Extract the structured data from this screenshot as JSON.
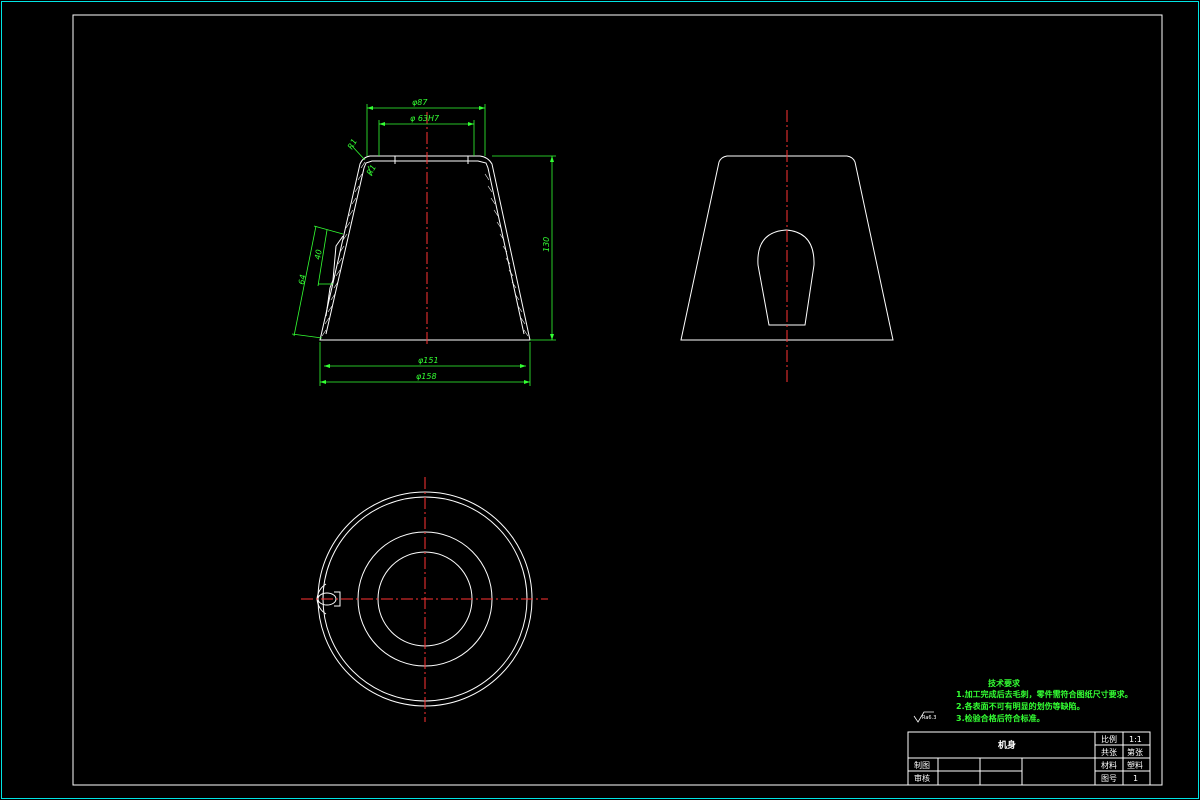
{
  "colors": {
    "background": "#000000",
    "frame": "#00e5e5",
    "geometry": "#ffffff",
    "center_line": "#ff3333",
    "dimension": "#33ff33"
  },
  "dimensions": {
    "top_outer_dia": "φ87",
    "top_inner_dia": "φ 63H7",
    "height": "130",
    "bottom_inner_dia": "φ151",
    "bottom_outer_dia": "φ158",
    "fillet_outer": "R1",
    "fillet_inner": "R1",
    "side_len_a": "64",
    "side_len_b": "40"
  },
  "surface_mark": "Ra6.3",
  "notes": {
    "title": "技术要求",
    "items": [
      "1.加工完成后去毛刺，零件需符合图纸尺寸要求。",
      "2.各表面不可有明显的划伤等缺陷。",
      "3.检验合格后符合标准。"
    ]
  },
  "title_block": {
    "part_name": "机身",
    "scale_label": "比例",
    "scale_value": "1:1",
    "qty_label": "共张",
    "qty_value": "第张",
    "material_label": "材料",
    "material_value": "塑料",
    "drawing_no_label": "图号",
    "drawing_no_value": "1",
    "drafter_label": "制图",
    "checker_label": "审核"
  }
}
